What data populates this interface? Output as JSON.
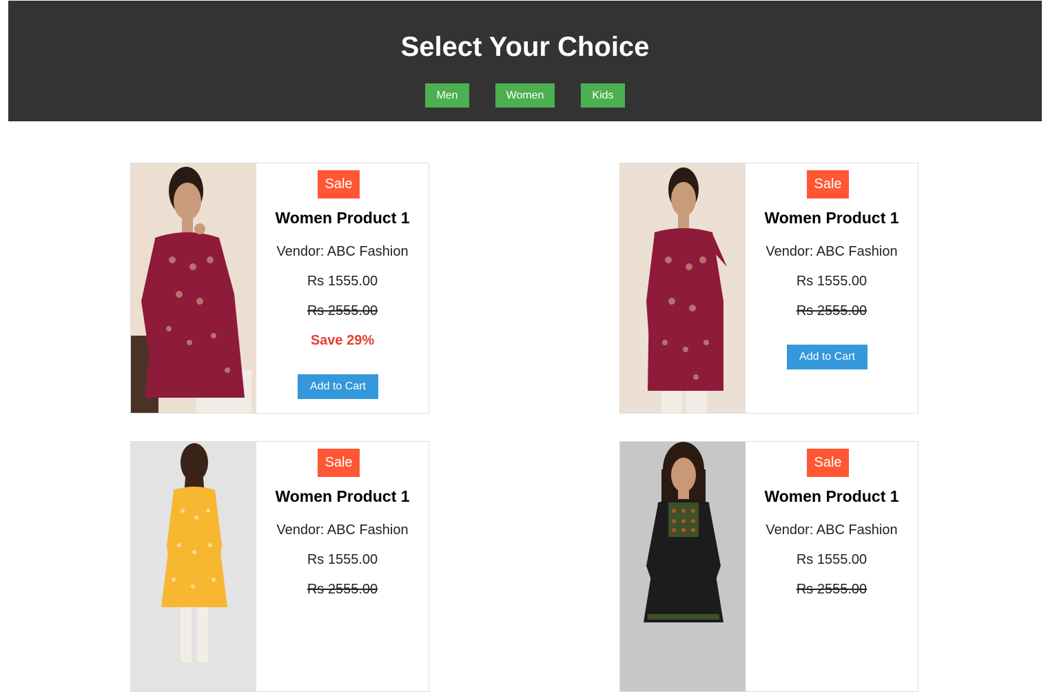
{
  "header": {
    "title": "Select Your Choice",
    "nav": [
      "Men",
      "Women",
      "Kids"
    ]
  },
  "colors": {
    "header_bg": "#333333",
    "nav_button": "#4caf50",
    "sale_badge": "#ff5733",
    "save_text": "#e53e2e",
    "cart_button": "#3498db"
  },
  "products": [
    {
      "badge": "Sale",
      "name": "Women Product 1",
      "vendor": "Vendor: ABC Fashion",
      "price": "Rs 1555.00",
      "old_price": "Rs 2555.00",
      "save": "Save 29%",
      "cart": "Add to Cart",
      "garment_color": "#8e1b3a"
    },
    {
      "badge": "Sale",
      "name": "Women Product 1",
      "vendor": "Vendor: ABC Fashion",
      "price": "Rs 1555.00",
      "old_price": "Rs 2555.00",
      "save": "",
      "cart": "Add to Cart",
      "garment_color": "#8e1b3a"
    },
    {
      "badge": "Sale",
      "name": "Women Product 1",
      "vendor": "Vendor: ABC Fashion",
      "price": "Rs 1555.00",
      "old_price": "Rs 2555.00",
      "save": "",
      "cart": "",
      "garment_color": "#f7b731"
    },
    {
      "badge": "Sale",
      "name": "Women Product 1",
      "vendor": "Vendor: ABC Fashion",
      "price": "Rs 1555.00",
      "old_price": "Rs 2555.00",
      "save": "",
      "cart": "",
      "garment_color": "#1c1c1c"
    }
  ]
}
